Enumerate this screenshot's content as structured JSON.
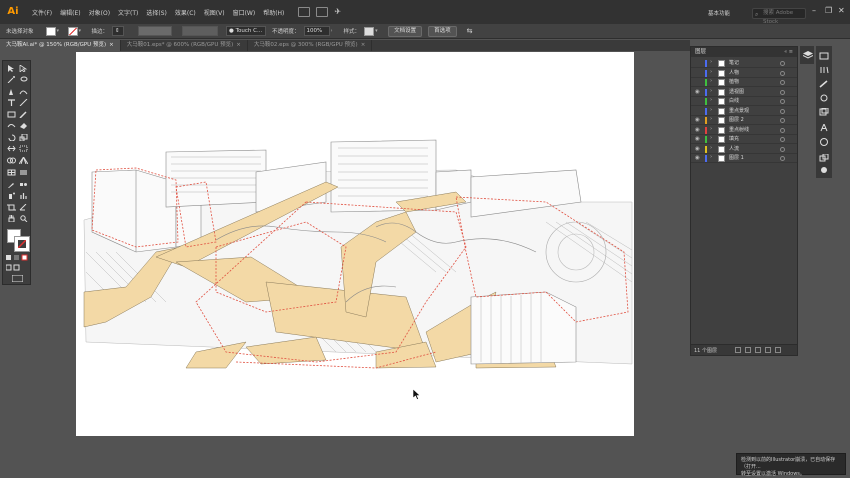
{
  "app": {
    "logo": "Ai"
  },
  "menu": [
    "文件(F)",
    "编辑(E)",
    "对象(O)",
    "文字(T)",
    "选择(S)",
    "效果(C)",
    "视图(V)",
    "窗口(W)",
    "帮助(H)"
  ],
  "workspace_label": "基本功能",
  "stock_search": {
    "placeholder": "搜索 Adobe Stock"
  },
  "control_bar": {
    "selection_status": "未选择对象",
    "stroke_label": "描边：",
    "brush_label": "Touch C...",
    "opacity_label": "不透明度：",
    "opacity_value": "100%",
    "style_label": "样式：",
    "doc_setup_button": "文档设置",
    "prefs_button": "首选项"
  },
  "tabs": [
    {
      "label": "大马鞍AI.ai* @ 150% (RGB/GPU 预览)",
      "active": true
    },
    {
      "label": "大马鞍01.eps* @ 600% (RGB/GPU 预览)",
      "active": false
    },
    {
      "label": "大马鞍02.eps @ 300% (RGB/GPU 预览)",
      "active": false
    }
  ],
  "layers_panel": {
    "title": "图层",
    "layers": [
      {
        "name": "笔记",
        "color": "#4c6cf0",
        "visible": false
      },
      {
        "name": "人物",
        "color": "#4c6cf0",
        "visible": false
      },
      {
        "name": "植物",
        "color": "#3fbf3f",
        "visible": false
      },
      {
        "name": "透视图",
        "color": "#4c6cf0",
        "visible": true
      },
      {
        "name": "白线",
        "color": "#3fbf3f",
        "visible": false
      },
      {
        "name": "重点景观",
        "color": "#4c6cf0",
        "visible": false
      },
      {
        "name": "图层 2",
        "color": "#e0a020",
        "visible": true
      },
      {
        "name": "重点射线",
        "color": "#e04040",
        "visible": true
      },
      {
        "name": "填充",
        "color": "#3fbf3f",
        "visible": true
      },
      {
        "name": "人流",
        "color": "#e0c020",
        "visible": true
      },
      {
        "name": "图层 1",
        "color": "#4c6cf0",
        "visible": true
      }
    ],
    "count_label": "11 个图层"
  },
  "notification": {
    "line1": "检测到以前的Illustrator崩溃，已自动保存（打开...",
    "line2": "转至设置以激活 Windows。"
  },
  "icons": [
    "ai-logo",
    "selection-tool-icon",
    "direct-selection-icon",
    "pen-icon",
    "type-icon",
    "line-icon",
    "rectangle-icon",
    "paintbrush-icon",
    "eraser-icon",
    "rotate-icon",
    "scale-icon",
    "width-icon",
    "shape-builder-icon",
    "perspective-grid-icon",
    "mesh-icon",
    "gradient-icon",
    "eyedropper-icon",
    "blend-icon",
    "symbol-sprayer-icon",
    "graph-icon",
    "artboard-icon",
    "slice-icon",
    "hand-icon",
    "zoom-icon",
    "layers-icon",
    "search-icon"
  ],
  "colors": {
    "accent_logo": "#ff9a00",
    "highlight_fill": "#f3d9a6",
    "red_dash": "#e05040"
  }
}
